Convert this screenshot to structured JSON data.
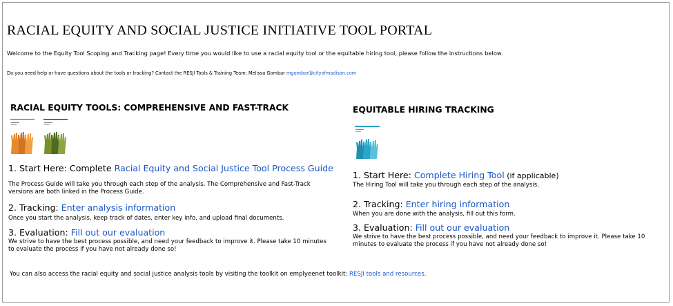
{
  "page": {
    "title": "RACIAL EQUITY AND SOCIAL JUSTICE INITIATIVE TOOL PORTAL",
    "welcome": "Welcome to the Equity Tool Scoping and Tracking page! Every time you would like to use a racial equity tool or the equitable hiring tool, please follow the instructions below.",
    "help_text": "Do you need help or have questions about the tools or tracking? Contact the RESJI Tools & Training Team: Melissa Gombar ",
    "help_email": "mgombar@cityofmadison.com"
  },
  "left": {
    "heading": "RACIAL EQUITY TOOLS: COMPREHENSIVE AND FAST-TRACK",
    "step1_prefix": "1. Start Here: Complete ",
    "step1_link": "Racial Equity and Social Justice Tool Process Guide",
    "step1_desc": "The Process Guide will take you through each step of the analysis. The Comprehensive and Fast-Track versions are both linked in the Process Guide.",
    "step2_prefix": "2. Tracking: ",
    "step2_link": "Enter analysis information",
    "step2_desc": "Once you start the analysis, keep track of dates, enter key info, and upload final documents.",
    "step3_prefix": "3. Evaluation: ",
    "step3_link": "Fill out our evaluation",
    "step3_desc": "We strive to have the best process possible, and need your feedback to improve it. Please take 10 minutes to evaluate the process if you have not already done so!"
  },
  "right": {
    "heading": "EQUITABLE HIRING TRACKING",
    "step1_prefix": "1. Start Here: ",
    "step1_link": "Complete Hiring Tool",
    "step1_suffix": " (if applicable)",
    "step1_desc": "The Hiring Tool will take you through each step of the analysis.",
    "step2_prefix": "2. Tracking: ",
    "step2_link": "Enter hiring information",
    "step2_desc": "When you are done with the analysis, fill out this form.",
    "step3_prefix": "3. Evaluation: ",
    "step3_link": "Fill out our evaluation",
    "step3_desc": "We strive to have the best process possible, and need your feedback to improve it. Please take 10 minutes to evaluate the process if you have not already done so!"
  },
  "footer": {
    "text": "You can also access the racial equity and social justice analysis tools by visiting the toolkit on emplyeenet toolkit: ",
    "link": "RESJI tools and resources."
  },
  "colors": {
    "link": "#1a56c8",
    "hands_orange": "#e58a2e",
    "hands_green": "#6a8a2e",
    "hands_blue": "#2aa6c8"
  },
  "icons": {
    "thumb_comprehensive": "hands-thumbnail-orange",
    "thumb_fasttrack": "hands-thumbnail-green",
    "thumb_hiring": "hands-thumbnail-blue"
  }
}
